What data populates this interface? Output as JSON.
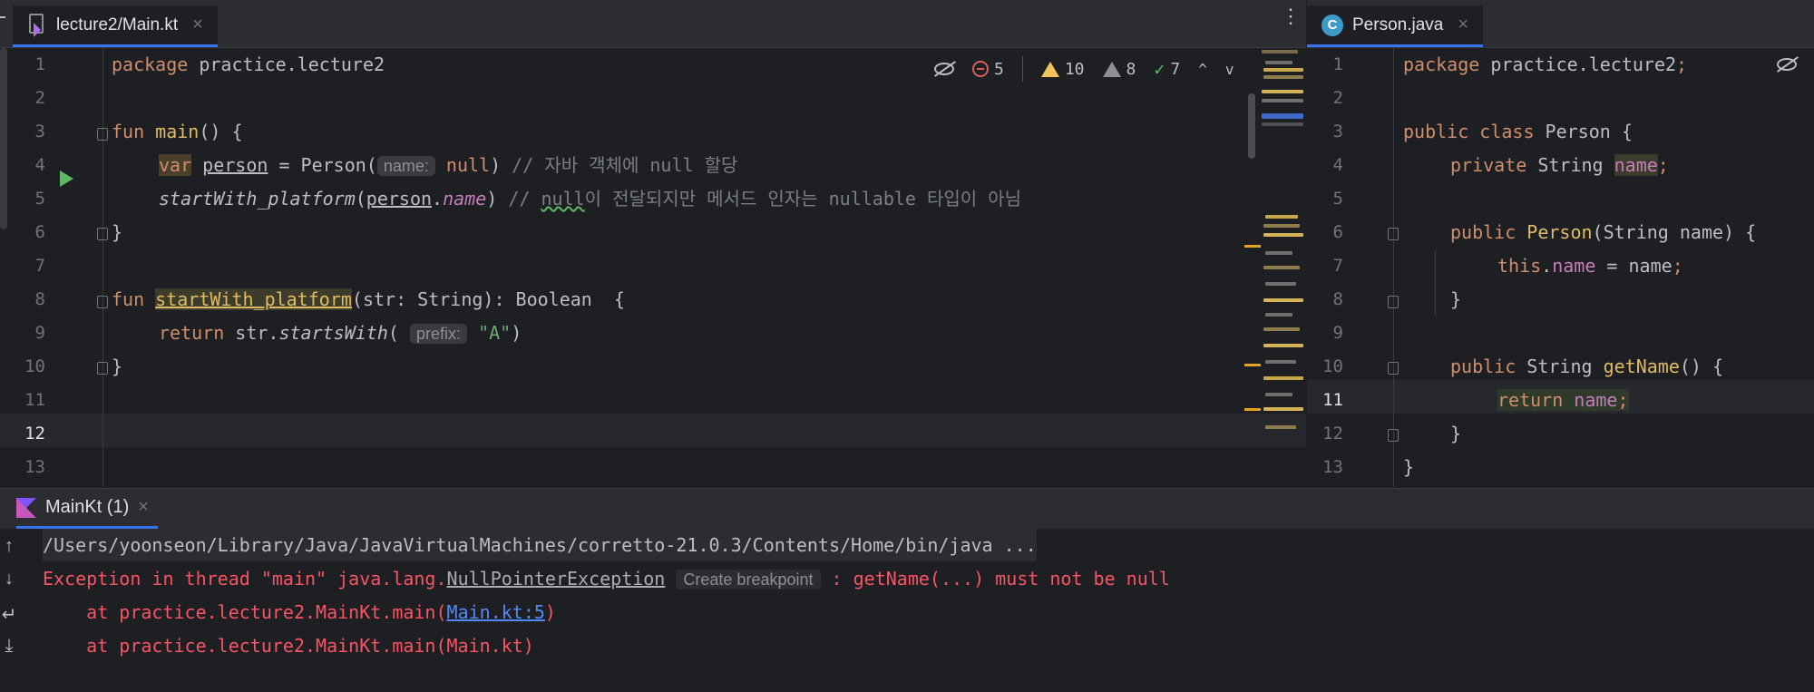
{
  "left_tab": {
    "label": "lecture2/Main.kt",
    "close": "×",
    "icon": "kotlin-file-icon"
  },
  "right_tab": {
    "label": "Person.java",
    "close": "×",
    "icon": "java-class-icon"
  },
  "more_menu": "⋮",
  "inspections": {
    "errors": "5",
    "warnings": "10",
    "weak_warnings": "8",
    "typos": "7",
    "prev": "^",
    "next": "v"
  },
  "left_editor": {
    "line_numbers": [
      "1",
      "2",
      "3",
      "4",
      "5",
      "6",
      "7",
      "8",
      "9",
      "10",
      "11",
      "12",
      "13"
    ],
    "current_line": "12",
    "code": {
      "l1_kw": "package",
      "l1_rest": " practice.lecture2",
      "l3_kw": "fun",
      "l3_name": "main",
      "l3_rest": "() {",
      "l4_kw": "var",
      "l4_var": "person",
      "l4_mid": " = Person(",
      "l4_hint": "name:",
      "l4_null": "null",
      "l4_close": ")",
      "l4_comment": " // 자바 객체에 null 할당",
      "l5_fn": "startWith_platform",
      "l5_open": "(",
      "l5_obj": "person",
      "l5_dot": ".",
      "l5_prop": "name",
      "l5_close": ")",
      "l5_comment_a": " // ",
      "l5_comment_null": "null",
      "l5_comment_b": "이 전달되지만 메서드 인자는 nullable 타입이 아님",
      "l6": "}",
      "l8_kw": "fun",
      "l8_name": "startWith_platform",
      "l8_rest": "(str: String): Boolean  {",
      "l9_kw": "return",
      "l9_mid": " str.",
      "l9_fn": "startsWith",
      "l9_open": "(",
      "l9_hint": "prefix:",
      "l9_str": "\"A\"",
      "l9_close": ")",
      "l10": "}"
    }
  },
  "right_editor": {
    "line_numbers": [
      "1",
      "2",
      "3",
      "4",
      "5",
      "6",
      "7",
      "8",
      "9",
      "10",
      "11",
      "12",
      "13"
    ],
    "current_line": "11",
    "code": {
      "l1_kw": "package",
      "l1_rest": " practice.lecture2",
      "l1_semi": ";",
      "l3_kw": "public class",
      "l3_rest": " Person {",
      "l4_kw": "private",
      "l4_type": " String ",
      "l4_field": "name",
      "l4_semi": ";",
      "l6_kw": "public",
      "l6_name": " Person",
      "l6_rest": "(String name) {",
      "l7_this": "this",
      "l7_dot": ".",
      "l7_field": "name",
      "l7_rest": " = name",
      "l7_semi": ";",
      "l8": "}",
      "l10_kw": "public",
      "l10_type": " String ",
      "l10_name": "getName",
      "l10_rest": "() {",
      "l11_kw": "return",
      "l11_field": " name",
      "l11_semi": ";",
      "l12": "}",
      "l13": "}"
    }
  },
  "run_panel": {
    "tab_label": "MainKt (1)",
    "tab_close": "×",
    "command": "/Users/yoonseon/Library/Java/JavaVirtualMachines/corretto-21.0.3/Contents/Home/bin/java ...",
    "exception_prefix": "Exception in thread \"main\" java.lang.",
    "exception_class": "NullPointerException",
    "breakpoint_chip": "Create breakpoint",
    "exception_suffix": " : getName(...) must not be null",
    "trace1_prefix": "    at practice.lecture2.MainKt.main(",
    "trace1_link": "Main.kt:5",
    "trace1_suffix": ")",
    "trace2": "    at practice.lecture2.MainKt.main(Main.kt)",
    "tools": [
      "↑",
      "↓",
      "↵",
      "⤓"
    ]
  },
  "colors": {
    "keyword": "#cf8e6d",
    "function_decl": "#e0bb65",
    "string": "#6aab73",
    "comment": "#7a7e85",
    "property": "#c77dbb",
    "error_text": "#f75464",
    "link": "#548af7",
    "accent": "#3574f0"
  }
}
